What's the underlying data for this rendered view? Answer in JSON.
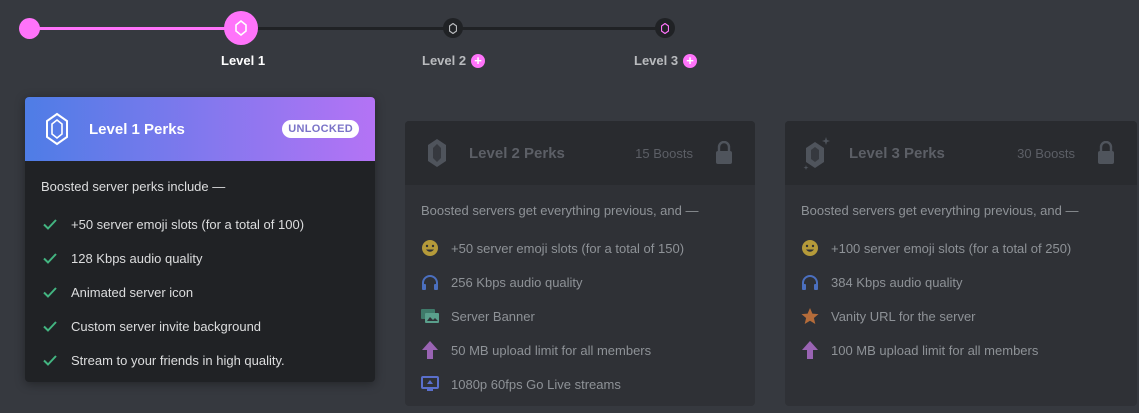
{
  "levels": {
    "level1_label": "Level 1",
    "level2_label": "Level 2",
    "level3_label": "Level 3"
  },
  "cards": [
    {
      "title": "Level 1 Perks",
      "badge": "UNLOCKED",
      "intro": "Boosted server perks include —",
      "perks": [
        {
          "icon": "check-icon",
          "text": "+50 server emoji slots (for a total of 100)"
        },
        {
          "icon": "check-icon",
          "text": "128 Kbps audio quality"
        },
        {
          "icon": "check-icon",
          "text": "Animated server icon"
        },
        {
          "icon": "check-icon",
          "text": "Custom server invite background"
        },
        {
          "icon": "check-icon",
          "text": "Stream to your friends in high quality."
        }
      ]
    },
    {
      "title": "Level 2 Perks",
      "boosts": "15 Boosts",
      "intro": "Boosted servers get everything previous, and —",
      "perks": [
        {
          "icon": "emoji-icon",
          "text": "+50 server emoji slots (for a total of 150)"
        },
        {
          "icon": "headphones-icon",
          "text": "256 Kbps audio quality"
        },
        {
          "icon": "banner-icon",
          "text": "Server Banner"
        },
        {
          "icon": "upload-arrow-icon",
          "text": "50 MB upload limit for all members"
        },
        {
          "icon": "screen-share-icon",
          "text": "1080p 60fps Go Live streams"
        }
      ]
    },
    {
      "title": "Level 3 Perks",
      "boosts": "30 Boosts",
      "intro": "Boosted servers get everything previous, and —",
      "perks": [
        {
          "icon": "emoji-icon",
          "text": "+100 server emoji slots (for a total of 250)"
        },
        {
          "icon": "headphones-icon",
          "text": "384 Kbps audio quality"
        },
        {
          "icon": "star-icon",
          "text": "Vanity URL for the server"
        },
        {
          "icon": "upload-arrow-icon",
          "text": "100 MB upload limit for all members"
        }
      ]
    }
  ],
  "colors": {
    "background": "#36393f",
    "accent_pink": "#ff73fa",
    "check_green": "#43b581",
    "card_dark": "#202225"
  }
}
